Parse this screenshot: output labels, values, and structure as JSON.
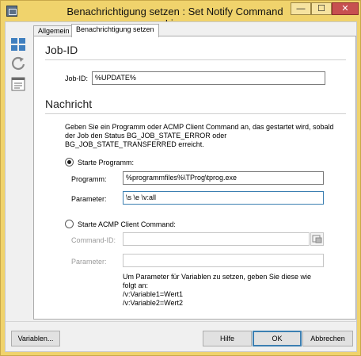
{
  "window": {
    "title": "Benachrichtigung setzen : Set Notify Command Line",
    "min_glyph": "—",
    "max_glyph": "☐",
    "close_glyph": "✕"
  },
  "sidebar": {
    "icons": [
      "windows-grid-icon",
      "refresh-icon",
      "form-icon"
    ]
  },
  "tabs": [
    {
      "label": "Allgemein",
      "active": false
    },
    {
      "label": "Benachrichtigung setzen",
      "active": true
    }
  ],
  "job_section": {
    "heading": "Job-ID",
    "job_id_label": "Job-ID:",
    "job_id_value": "%UPDATE%"
  },
  "message_section": {
    "heading": "Nachricht",
    "description": "Geben Sie ein Programm oder ACMP Client Command an, das gestartet wird, sobald der Job den Status BG_JOB_STATE_ERROR oder BG_JOB_STATE_TRANSFERRED erreicht.",
    "start_program": {
      "label": "Starte Programm:",
      "selected": true,
      "program_label": "Programm:",
      "program_value": "%programmfiles%\\TProg\\tprog.exe",
      "params_label": "Parameter:",
      "params_value": "\\s \\e \\v:all"
    },
    "start_client_command": {
      "label": "Starte ACMP Client Command:",
      "selected": false,
      "command_id_label": "Command-ID:",
      "command_id_value": "",
      "params_label": "Parameter:",
      "params_value": "",
      "hint_lines": [
        "Um Parameter für Variablen zu setzen, geben Sie diese wie",
        "folgt an:",
        "/v:Variable1=Wert1",
        "/v:Variable2=Wert2"
      ]
    }
  },
  "footer": {
    "variables_label": "Variablen...",
    "help_label": "Hilfe",
    "ok_label": "OK",
    "cancel_label": "Abbrechen"
  },
  "colors": {
    "titlebar": "#f0d36c",
    "close_button": "#c75050",
    "focus_border": "#3c7fb1"
  }
}
